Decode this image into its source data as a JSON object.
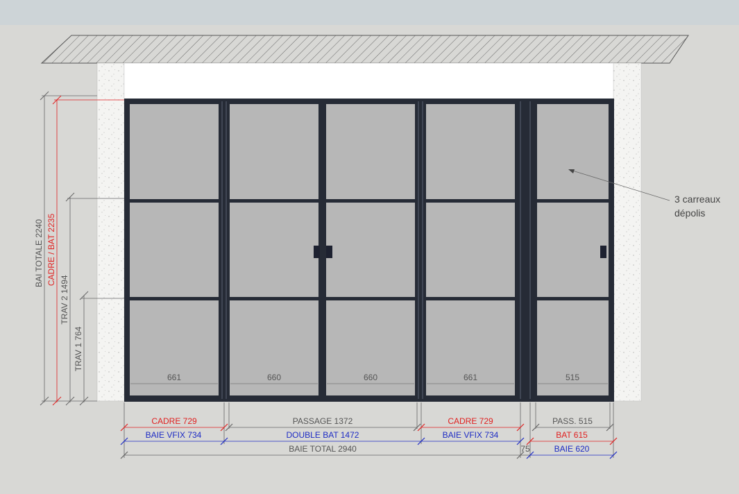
{
  "dimensions": {
    "bai_totale": "BAI TOTALE 2240",
    "cadre_bat": "CADRE / BAT 2235",
    "trav2": "TRAV 2 1494",
    "trav1": "TRAV 1 764",
    "glass_widths": [
      "661",
      "660",
      "660",
      "661",
      "515"
    ],
    "cadre_left": "CADRE 729",
    "passage": "PASSAGE 1372",
    "cadre_right": "CADRE 729",
    "pass_small": "PASS. 515",
    "baie_vfix_left": "BAIE VFIX 734",
    "double_bat": "DOUBLE BAT 1472",
    "baie_vfix_right": "BAIE VFIX 734",
    "bat": "BAT 615",
    "baie_total": "BAIE TOTAL 2940",
    "gap": "75",
    "baie_small": "BAIE 620"
  },
  "note": {
    "line1": "3 carreaux",
    "line2": "dépolis"
  },
  "colors": {
    "red": "#e02020",
    "blue": "#1d2bc4",
    "gray": "#555555",
    "frame": "#262b36",
    "glass": "#b7b7b7",
    "wall": "#f4f4f2"
  }
}
